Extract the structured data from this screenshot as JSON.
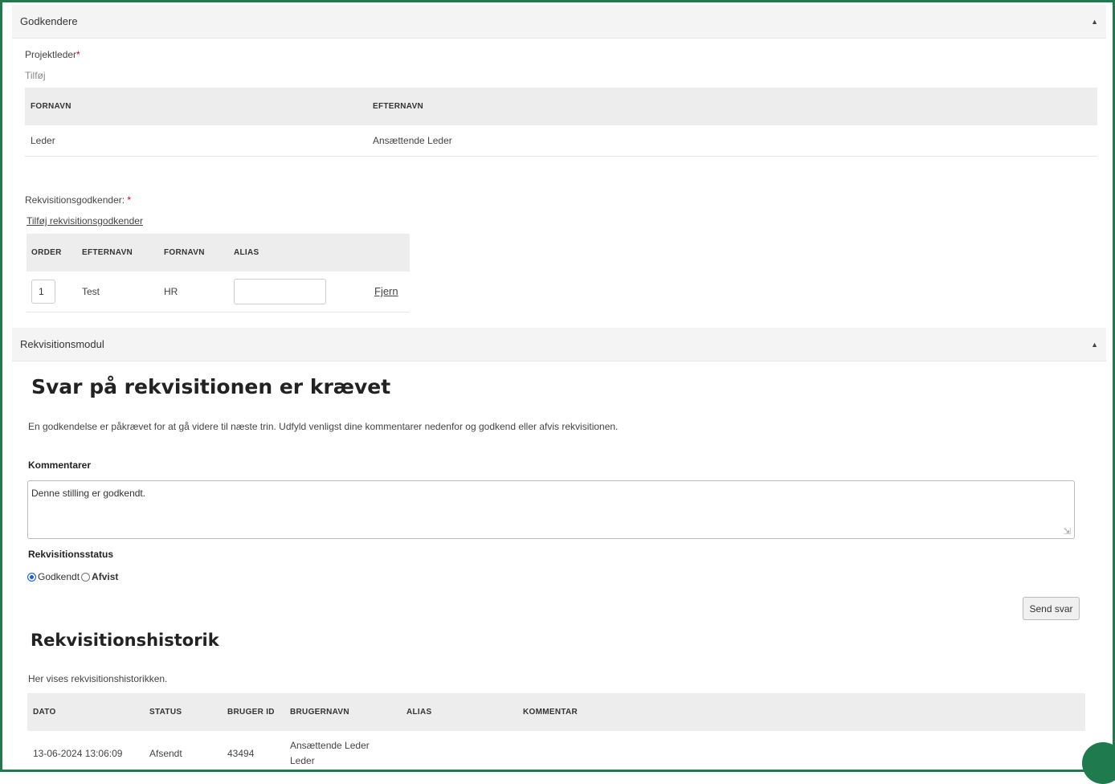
{
  "approvers_panel": {
    "title": "Godkendere",
    "project_leader_label": "Projektleder",
    "required_mark": "*",
    "add_link": "Tilføj",
    "columns": [
      "FORNAVN",
      "EFTERNAVN"
    ],
    "rows": [
      {
        "first": "Leder",
        "last": "Ansættende Leder"
      }
    ],
    "req_approver_label": "Rekvisitionsgodkender:",
    "add_req_approver_link": "Tilføj rekvisitionsgodkender",
    "req_columns": [
      "ORDER",
      "EFTERNAVN",
      "FORNAVN",
      "ALIAS"
    ],
    "req_rows": [
      {
        "order": "1",
        "last": "Test",
        "first": "HR",
        "alias": "",
        "remove": "Fjern"
      }
    ]
  },
  "requisition_panel": {
    "title": "Rekvisitionsmodul",
    "heading": "Svar på rekvisitionen er krævet",
    "description": "En godkendelse er påkrævet for at gå videre til næste trin. Udfyld venligst dine kommentarer nedenfor og godkend eller afvis rekvisitionen.",
    "comments_label": "Kommentarer",
    "comments_value": "Denne stilling er godkendt.",
    "status_label": "Rekvisitionsstatus",
    "status_options": [
      "Godkendt",
      "Afvist"
    ],
    "status_selected": "Godkendt",
    "send_button": "Send svar",
    "history_heading": "Rekvisitionshistorik",
    "history_description": "Her vises rekvisitionshistorikken.",
    "history_columns": [
      "DATO",
      "STATUS",
      "BRUGER ID",
      "BRUGERNAVN",
      "ALIAS",
      "KOMMENTAR"
    ],
    "history_rows": [
      {
        "date": "13-06-2024 13:06:09",
        "status": "Afsendt",
        "user_id": "43494",
        "username": "Ansættende Leder Leder",
        "alias": "",
        "comment": ""
      }
    ]
  },
  "colors": {
    "frame": "#1f7a4d",
    "header_bg": "#f4f4f4",
    "table_head_bg": "#ededed",
    "required": "#d0021b",
    "radio_selected": "#1a5fd6"
  },
  "icons": {
    "collapse": "caret-up-icon",
    "chat": "chat-icon"
  }
}
